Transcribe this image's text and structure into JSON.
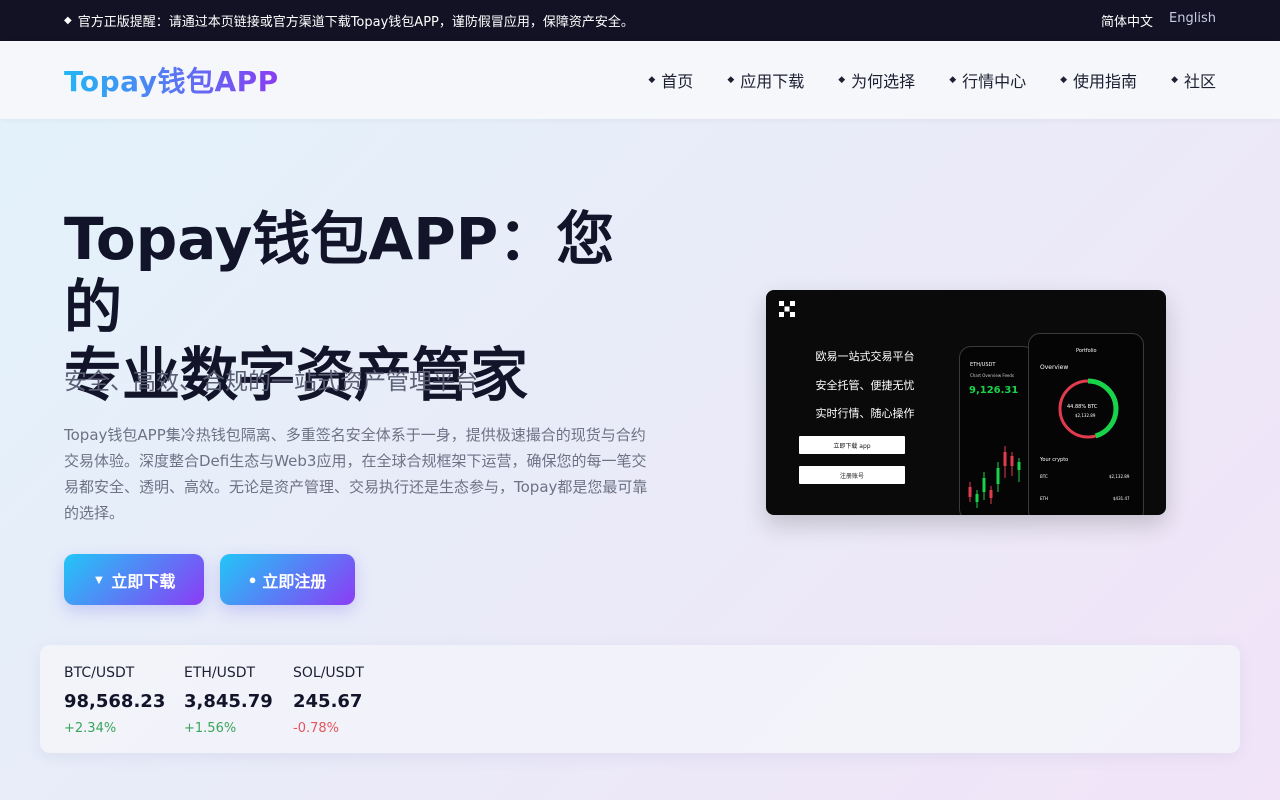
{
  "topbar": {
    "notice_icon": "diamond-icon",
    "notice": "官方正版提醒：请通过本页链接或官方渠道下载Topay钱包APP，谨防假冒应用，保障资产安全。",
    "lang_active": "简体中文",
    "lang_other": "English"
  },
  "header": {
    "logo": "Topay钱包APP",
    "nav": [
      {
        "label": "首页",
        "icon": "diamond-icon"
      },
      {
        "label": "应用下载",
        "icon": "diamond-icon"
      },
      {
        "label": "为何选择",
        "icon": "diamond-icon"
      },
      {
        "label": "行情中心",
        "icon": "diamond-icon"
      },
      {
        "label": "使用指南",
        "icon": "diamond-icon"
      },
      {
        "label": "社区",
        "icon": "diamond-icon"
      }
    ]
  },
  "hero": {
    "title_line1": "Topay钱包APP：您的",
    "title_line2": "专业数字资产管家",
    "subtitle": "安全、高效、合规的一站式资产管理平台",
    "description": "Topay钱包APP集冷热钱包隔离、多重签名安全体系于一身，提供极速撮合的现货与合约交易体验。深度整合Defi生态与Web3应用，在全球合规框架下运营，确保您的每一笔交易都安全、透明、高效。无论是资产管理、交易执行还是生态参与，Topay都是您最可靠的选择。",
    "btn_download": "立即下载",
    "btn_download_icon": "triangle-down-icon",
    "btn_register": "立即注册",
    "btn_register_icon": "dot-icon"
  },
  "promo": {
    "line1": "欧易一站式交易平台",
    "line2": "安全托管、便捷无忧",
    "line3": "实时行情、随心操作",
    "btn1": "立即下载 app",
    "btn2": "注册账号",
    "phone_back": {
      "pair": "ETH/USDT",
      "tabs": "Chart   Overview   Feeds",
      "price": "9,126.31"
    },
    "phone_front": {
      "title": "Portfolio",
      "overview": "Overview",
      "ring_pct": "44.88% BTC",
      "ring_value": "$2,132.89",
      "your_crypto": "Your crypto",
      "row1_name": "BTC",
      "row1_value": "$2,132.89",
      "row2_name": "ETH",
      "row2_value": "$431.47"
    },
    "colors": {
      "ring_green": "#19d44a",
      "ring_red": "#e23b4e"
    }
  },
  "ticker": [
    {
      "pair": "BTC/USDT",
      "price": "98,568.23",
      "change": "+2.34%",
      "direction": "up"
    },
    {
      "pair": "ETH/USDT",
      "price": "3,845.79",
      "change": "+1.56%",
      "direction": "up"
    },
    {
      "pair": "SOL/USDT",
      "price": "245.67",
      "change": "-0.78%",
      "direction": "down"
    }
  ],
  "colors": {
    "topbar_bg": "#121224",
    "accent_start": "#22c6f7",
    "accent_end": "#8b3cf5",
    "up": "#3aa55a",
    "down": "#e4565a"
  }
}
